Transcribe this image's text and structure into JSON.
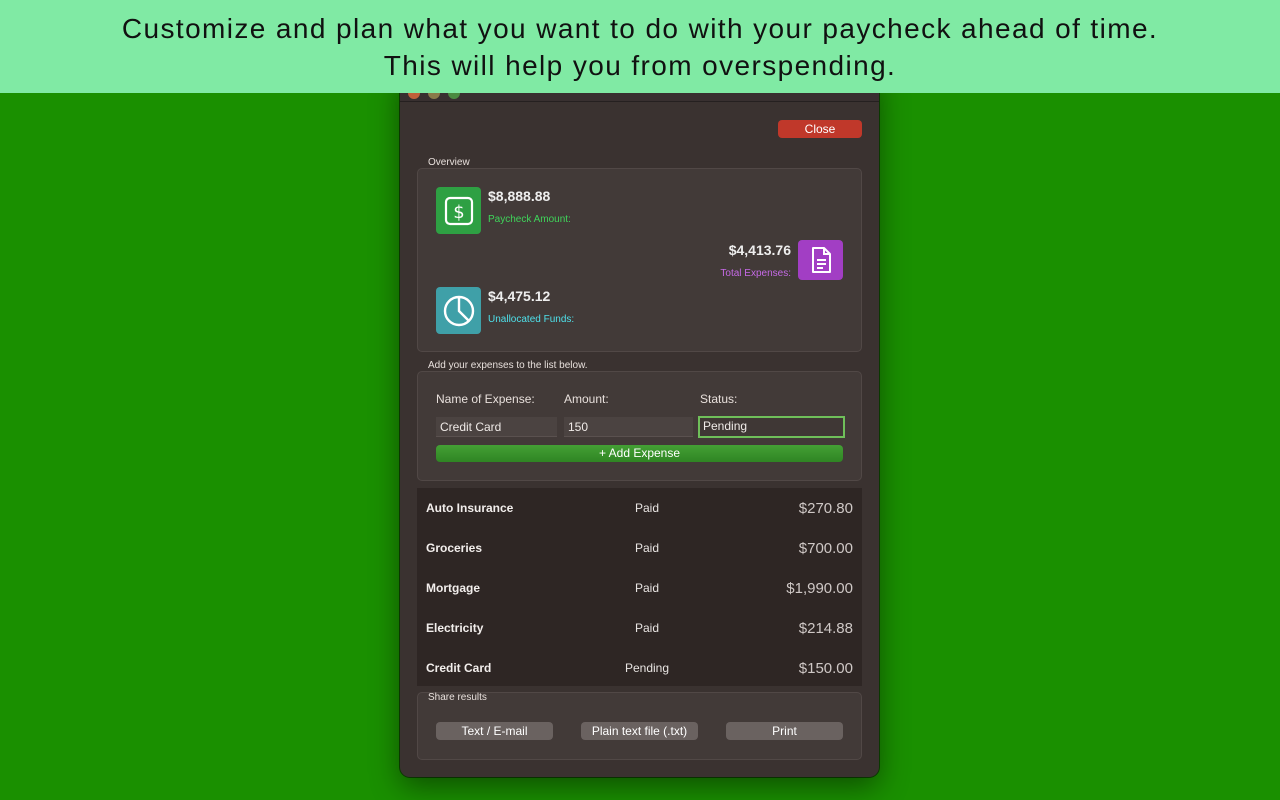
{
  "banner": {
    "line1": "Customize and plan what you want to do with your paycheck ahead of time.",
    "line2": "This will help you from overspending."
  },
  "window": {
    "close_label": "Close"
  },
  "overview": {
    "label": "Overview",
    "paycheck": {
      "amount": "$8,888.88",
      "caption": "Paycheck Amount:",
      "icon": "dollar-icon",
      "color": "#2ea043"
    },
    "expenses": {
      "amount": "$4,413.76",
      "caption": "Total Expenses:",
      "icon": "document-icon",
      "color": "#a23ec4"
    },
    "unallocated": {
      "amount": "$4,475.12",
      "caption": "Unallocated Funds:",
      "icon": "pie-chart-icon",
      "color": "#3fa0a8"
    }
  },
  "add_expense": {
    "label": "Add your expenses to the list below.",
    "name_label": "Name of Expense:",
    "amount_label": "Amount:",
    "status_label": "Status:",
    "name_value": "Credit Card",
    "amount_value": "150",
    "status_value": "Pending",
    "button_label": "Add Expense"
  },
  "expenses": [
    {
      "name": "Auto Insurance",
      "status": "Paid",
      "amount": "$270.80"
    },
    {
      "name": "Groceries",
      "status": "Paid",
      "amount": "$700.00"
    },
    {
      "name": "Mortgage",
      "status": "Paid",
      "amount": "$1,990.00"
    },
    {
      "name": "Electricity",
      "status": "Paid",
      "amount": "$214.88"
    },
    {
      "name": "Credit Card",
      "status": "Pending",
      "amount": "$150.00"
    }
  ],
  "share": {
    "label": "Share results",
    "buttons": [
      "Text / E-mail",
      "Plain text file (.txt)",
      "Print"
    ]
  }
}
